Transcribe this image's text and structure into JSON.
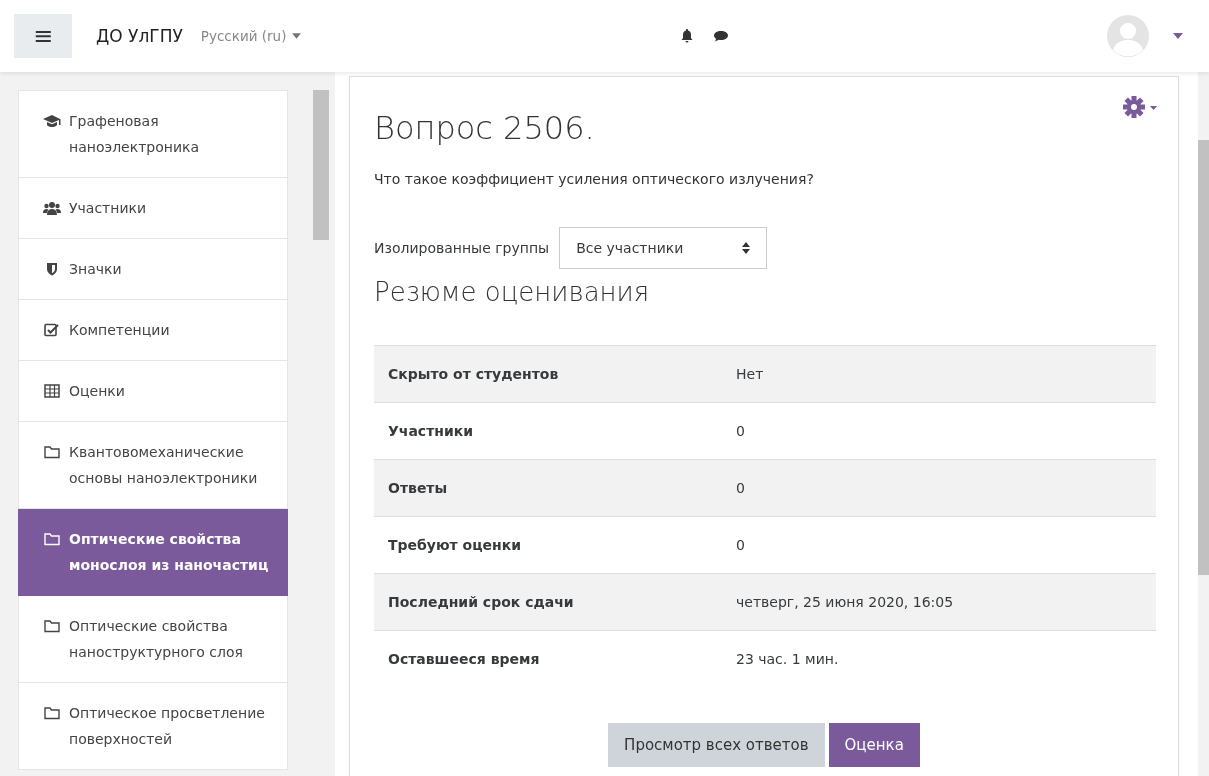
{
  "navbar": {
    "menu_icon": "≡",
    "site_name": "ДО УлГПУ",
    "language": "Русский (ru)"
  },
  "sidebar": {
    "items": [
      {
        "label": "Графеновая наноэлектроника",
        "kind": "course",
        "selected": false
      },
      {
        "label": "Участники",
        "kind": "users",
        "selected": false
      },
      {
        "label": "Значки",
        "kind": "badge",
        "selected": false
      },
      {
        "label": "Компетенции",
        "kind": "check",
        "selected": false
      },
      {
        "label": "Оценки",
        "kind": "table",
        "selected": false
      },
      {
        "label": "Квантовомеханические основы наноэлектроники",
        "kind": "folder",
        "selected": false
      },
      {
        "label": "Оптические свойства монослоя из наночастиц",
        "kind": "folder",
        "selected": true
      },
      {
        "label": "Оптические свойства наноструктурного слоя",
        "kind": "folder",
        "selected": false
      },
      {
        "label": "Оптическое просветление поверхностей",
        "kind": "folder",
        "selected": false
      }
    ]
  },
  "main": {
    "title": "Вопрос 2506.",
    "question": "Что такое коэффициент усиления оптического излучения?",
    "group_label": "Изолированные группы",
    "group_value": "Все участники",
    "summary_title": "Резюме оценивания",
    "summary_rows": [
      {
        "label": "Скрыто от студентов",
        "value": "Нет"
      },
      {
        "label": "Участники",
        "value": "0"
      },
      {
        "label": "Ответы",
        "value": "0"
      },
      {
        "label": "Требуют оценки",
        "value": "0"
      },
      {
        "label": "Последний срок сдачи",
        "value": "четверг, 25 июня 2020, 16:05"
      },
      {
        "label": "Оставшееся время",
        "value": "23 час. 1 мин."
      }
    ],
    "buttons": [
      {
        "label": "Просмотр всех ответов",
        "kind": "secondary"
      },
      {
        "label": "Оценка",
        "kind": "primary"
      }
    ]
  }
}
